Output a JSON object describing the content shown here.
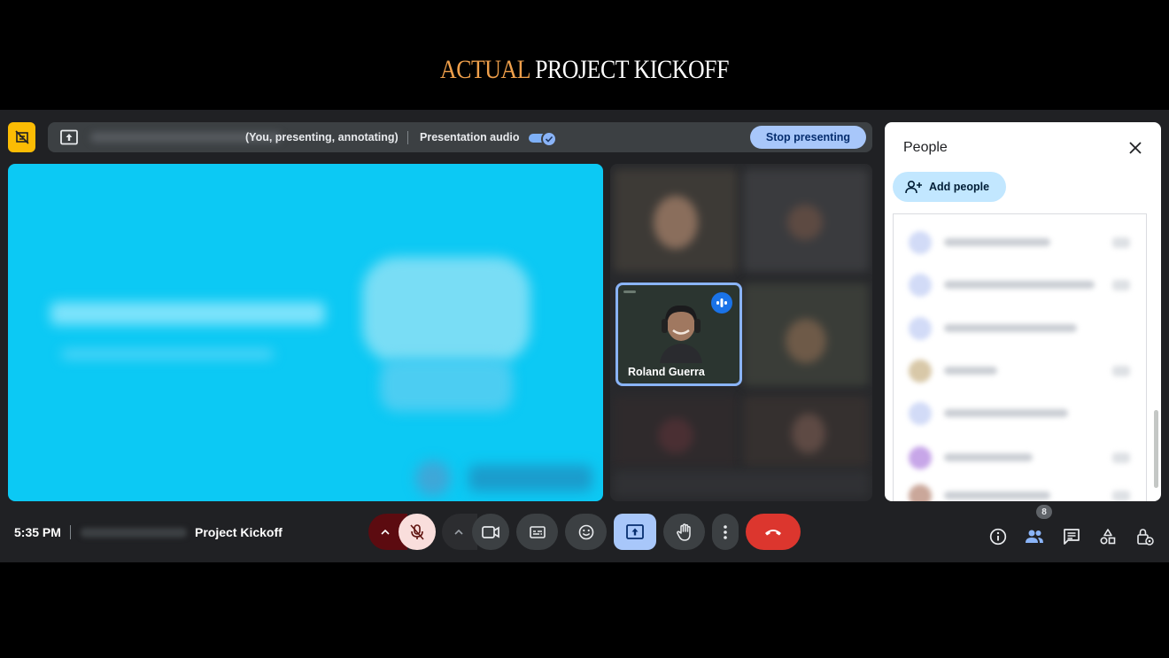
{
  "headline": {
    "accent": "ACTUAL",
    "rest": "PROJECT KICKOFF"
  },
  "presentation_bar": {
    "status": "(You, presenting, annotating)",
    "audio_label": "Presentation audio",
    "audio_enabled": true,
    "stop_label": "Stop presenting"
  },
  "participant_tile": {
    "name": "Roland Guerra"
  },
  "people_panel": {
    "title": "People",
    "add_label": "Add people",
    "close_icon": "close-icon"
  },
  "footer": {
    "time": "5:35 PM",
    "meeting_name": "Project Kickoff",
    "participant_count": "8"
  },
  "colors": {
    "accent": "#f0a04b",
    "annotate": "#fbbc04",
    "stage": "#0cc9f4",
    "end_call": "#dc362e",
    "present_active": "#a8c7fa"
  }
}
